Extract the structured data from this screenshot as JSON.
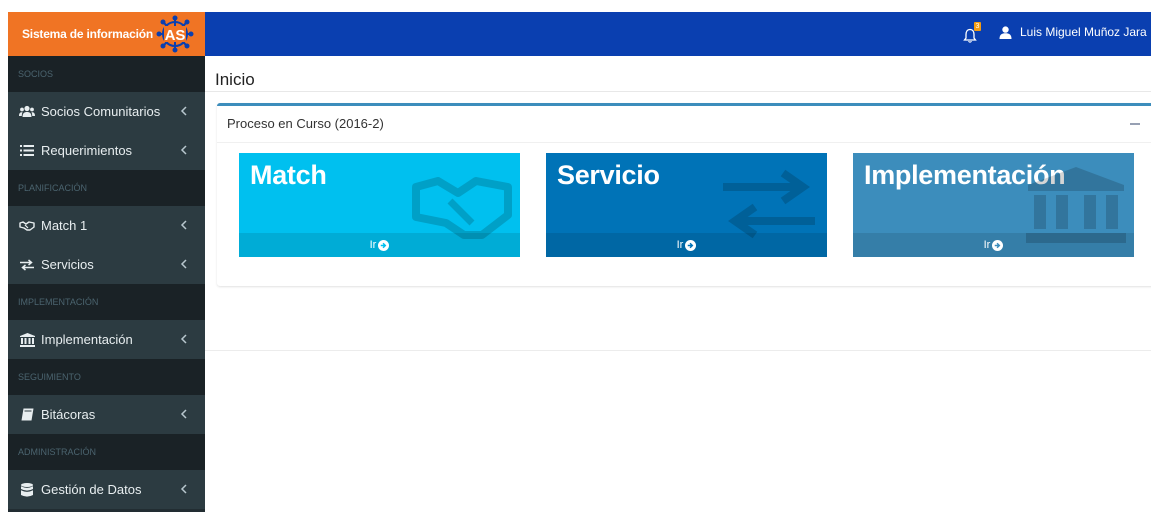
{
  "brand": {
    "title": "Sistema de información",
    "logo_text": "AS"
  },
  "header": {
    "user_name": "Luis Miguel Muñoz Jara",
    "notifications_count": "3",
    "icons": [
      "bell-icon",
      "user-icon"
    ]
  },
  "sidebar": {
    "sections": [
      "SOCIOS",
      "PLANIFICACIÓN",
      "IMPLEMENTACIÓN",
      "SEGUIMIENTO",
      "ADMINISTRACIÓN"
    ],
    "items": [
      {
        "label": "Socios Comunitarios",
        "icon": "users-icon"
      },
      {
        "label": "Requerimientos",
        "icon": "list-icon"
      },
      {
        "label": "Match 1",
        "icon": "handshake-icon"
      },
      {
        "label": "Servicios",
        "icon": "exchange-icon"
      },
      {
        "label": "Implementación",
        "icon": "bank-icon"
      },
      {
        "label": "Bitácoras",
        "icon": "book-icon"
      },
      {
        "label": "Gestión de Datos",
        "icon": "database-icon"
      }
    ]
  },
  "main": {
    "page_title": "Inicio",
    "box_title": "Proceso en Curso (2016-2)",
    "tiles": [
      {
        "title": "Match",
        "link": "Ir",
        "color": "#00c0ef",
        "icon": "handshake-icon"
      },
      {
        "title": "Servicio",
        "link": "Ir",
        "color": "#0073b7",
        "icon": "exchange-icon"
      },
      {
        "title": "Implementación",
        "link": "Ir",
        "color": "#3c8dbc",
        "icon": "bank-icon"
      }
    ]
  },
  "colors": {
    "brand": "#f07424",
    "navbar": "#0a3fb0",
    "sidebar": "#222d32",
    "box_border": "#3c8dbc"
  }
}
